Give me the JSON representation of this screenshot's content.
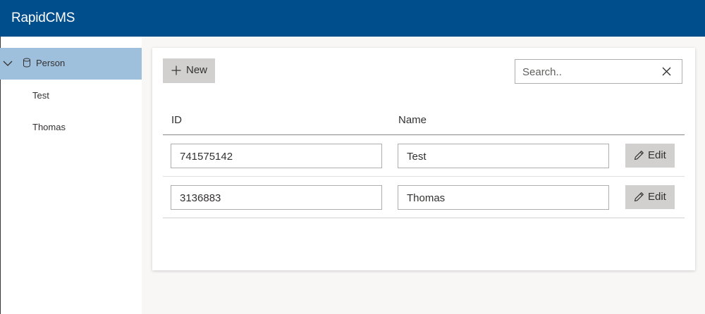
{
  "app": {
    "title": "RapidCMS"
  },
  "sidebar": {
    "collection": {
      "label": "Person",
      "icon": "database-icon",
      "expand_icon": "chevron-down-icon"
    },
    "items": [
      {
        "label": "Test"
      },
      {
        "label": "Thomas"
      }
    ]
  },
  "toolbar": {
    "new_label": "New",
    "new_icon": "plus-icon"
  },
  "search": {
    "placeholder": "Search..",
    "value": "",
    "clear_icon": "close-icon"
  },
  "table": {
    "columns": [
      "ID",
      "Name"
    ],
    "rows": [
      {
        "id": "741575142",
        "name": "Test",
        "action": "Edit"
      },
      {
        "id": "3136883",
        "name": "Thomas",
        "action": "Edit"
      }
    ]
  },
  "colors": {
    "header": "#004e8c",
    "sidebar_selected": "#9fc0dd",
    "button": "#d2d0ce"
  }
}
